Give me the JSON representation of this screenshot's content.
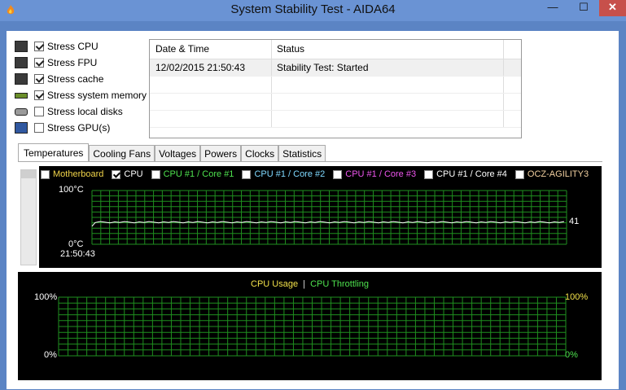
{
  "window": {
    "title": "System Stability Test - AIDA64",
    "min": "—",
    "max": "☐",
    "close": "✕"
  },
  "stress": [
    {
      "icon": "cpu-chip-icon",
      "label": "Stress CPU",
      "checked": true
    },
    {
      "icon": "fpu-chip-icon",
      "label": "Stress FPU",
      "checked": true
    },
    {
      "icon": "cache-chip-icon",
      "label": "Stress cache",
      "checked": true
    },
    {
      "icon": "memory-module-icon",
      "label": "Stress system memory",
      "checked": true
    },
    {
      "icon": "disk-drive-icon",
      "label": "Stress local disks",
      "checked": false
    },
    {
      "icon": "gpu-monitor-icon",
      "label": "Stress GPU(s)",
      "checked": false
    }
  ],
  "log": {
    "columns": [
      "Date & Time",
      "Status"
    ],
    "rows": [
      [
        "12/02/2015 21:50:43",
        "Stability Test: Started"
      ]
    ]
  },
  "tabs": [
    "Temperatures",
    "Cooling Fans",
    "Voltages",
    "Powers",
    "Clocks",
    "Statistics"
  ],
  "active_tab": "Temperatures",
  "temp_legend": [
    {
      "label": "Motherboard",
      "color": "#f2d54a",
      "checked": false
    },
    {
      "label": "CPU",
      "color": "#ffffff",
      "checked": true
    },
    {
      "label": "CPU #1 / Core #1",
      "color": "#4ee24e",
      "checked": false
    },
    {
      "label": "CPU #1 / Core #2",
      "color": "#7fd9ff",
      "checked": false
    },
    {
      "label": "CPU #1 / Core #3",
      "color": "#ee55ee",
      "checked": false
    },
    {
      "label": "CPU #1 / Core #4",
      "color": "#ffffff",
      "checked": false
    },
    {
      "label": "OCZ-AGILITY3",
      "color": "#f2d0a0",
      "checked": false
    }
  ],
  "temp_graph": {
    "y_top": "100°C",
    "y_bottom": "0°C",
    "time": "21:50:43",
    "current": "41",
    "level": 41
  },
  "usage_graph": {
    "title_usage": "CPU Usage",
    "separator": "|",
    "title_throttle": "CPU Throttling",
    "left_top": "100%",
    "left_bottom": "0%",
    "right_top": "100%",
    "right_bottom": "0%",
    "usage_color": "#f2e14a",
    "throttle_color": "#4ee24e"
  },
  "colors": {
    "grid": "#1f8f1f",
    "trace": "#ffffff"
  }
}
